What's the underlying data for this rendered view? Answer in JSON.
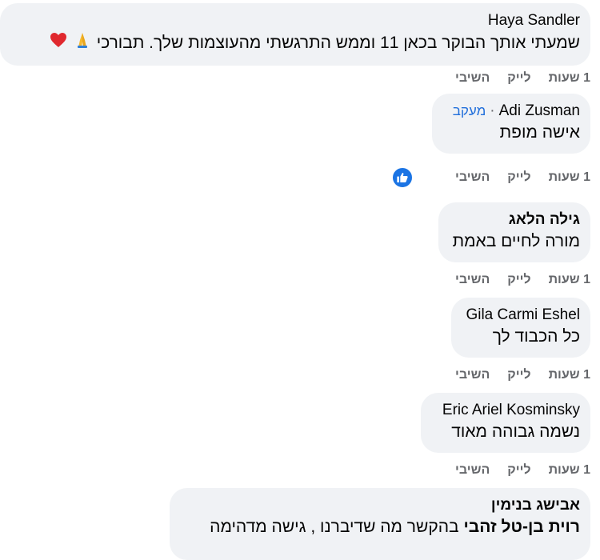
{
  "comments": [
    {
      "author": "Haya Sandler",
      "text": "שמעתי אותך הבוקר בכאן 11 וממש התרגשתי מהעוצמות שלך. תבורכי",
      "emoji": [
        "folded-hands",
        "red-heart"
      ],
      "time": "1 שעות",
      "like": "לייק",
      "reply": "השיבי"
    },
    {
      "author": "Adi Zusman",
      "follow": "מעקב",
      "text": "אישה מופת",
      "time": "1 שעות",
      "like": "לייק",
      "reply": "השיבי",
      "reaction": "like"
    },
    {
      "author": "גילה הלאג",
      "text": "מורה לחיים באמת",
      "time": "1 שעות",
      "like": "לייק",
      "reply": "השיבי"
    },
    {
      "author": "Gila Carmi Eshel",
      "text": "כל הכבוד לך",
      "time": "1 שעות",
      "like": "לייק",
      "reply": "השיבי"
    },
    {
      "author": "Eric Ariel Kosminsky",
      "text": "נשמה גבוהה מאוד",
      "time": "1 שעות",
      "like": "לייק",
      "reply": "השיבי"
    },
    {
      "author": "אבישג בנימין",
      "tagged": "רוית בן-טל זהבי",
      "text": "בהקשר מה שדיברנו , גישה מדהימה"
    }
  ],
  "colors": {
    "bubble": "#f0f2f5",
    "muted": "#65676b",
    "link": "#216fdb",
    "reaction": "#1b74e4"
  }
}
